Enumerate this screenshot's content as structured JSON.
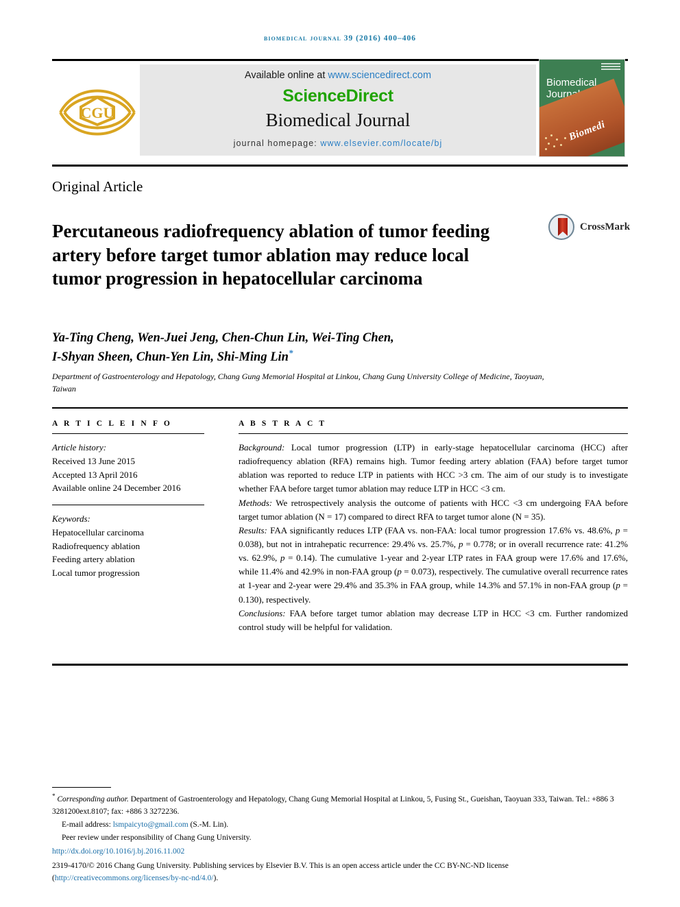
{
  "running_head": "Biomedical Journal 39 (2016) 400–406",
  "masthead": {
    "available_prefix": "Available online at ",
    "available_link": "www.sciencedirect.com",
    "sciencedirect": "ScienceDirect",
    "journal_name": "Biomedical Journal",
    "homepage_prefix": "journal homepage: ",
    "homepage_link": "www.elsevier.com/locate/bj",
    "logo_text": "CGU",
    "cover_title_line1": "Biomedical",
    "cover_title_line2": "Journal",
    "cover_script": "Biomedi"
  },
  "article": {
    "type": "Original Article",
    "title": "Percutaneous radiofrequency ablation of tumor feeding artery before target tumor ablation may reduce local tumor progression in hepatocellular carcinoma",
    "crossmark_label": "CrossMark",
    "authors_line1": "Ya-Ting Cheng, Wen-Juei Jeng, Chen-Chun Lin, Wei-Ting Chen,",
    "authors_line2": "I-Shyan Sheen, Chun-Yen Lin, Shi-Ming Lin",
    "author_star": "*",
    "affiliation": "Department of Gastroenterology and Hepatology, Chang Gung Memorial Hospital at Linkou, Chang Gung University College of Medicine, Taoyuan, Taiwan"
  },
  "article_info": {
    "heading": "A R T I C L E  I N F O",
    "history_label": "Article history:",
    "history": [
      "Received 13 June 2015",
      "Accepted 13 April 2016",
      "Available online 24 December 2016"
    ],
    "keywords_label": "Keywords:",
    "keywords": [
      "Hepatocellular carcinoma",
      "Radiofrequency ablation",
      "Feeding artery ablation",
      "Local tumor progression"
    ]
  },
  "abstract": {
    "heading": "A B S T R A C T",
    "background_label": "Background:",
    "background_text": " Local tumor progression (LTP) in early-stage hepatocellular carcinoma (HCC) after radiofrequency ablation (RFA) remains high. Tumor feeding artery ablation (FAA) before target tumor ablation was reported to reduce LTP in patients with HCC >3 cm. The aim of our study is to investigate whether FAA before target tumor ablation may reduce LTP in HCC <3 cm.",
    "methods_label": "Methods:",
    "methods_text": " We retrospectively analysis the outcome of patients with HCC <3 cm undergoing FAA before target tumor ablation (N = 17) compared to direct RFA to target tumor alone (N = 35).",
    "results_label": "Results:",
    "results_text_1": " FAA significantly reduces LTP (FAA vs. non-FAA: local tumor progression 17.6% vs. 48.6%, ",
    "results_p1": "p",
    "results_text_2": " = 0.038), but not in intrahepatic recurrence: 29.4% vs. 25.7%, ",
    "results_p2": "p",
    "results_text_3": " = 0.778; or in overall recurrence rate: 41.2% vs. 62.9%, ",
    "results_p3": "p",
    "results_text_4": " = 0.14). The cumulative 1-year and 2-year LTP rates in FAA group were 17.6% and 17.6%, while 11.4% and 42.9% in non-FAA group (",
    "results_p4": "p",
    "results_text_5": " = 0.073), respectively. The cumulative overall recurrence rates at 1-year and 2-year were 29.4% and 35.3% in FAA group, while 14.3% and 57.1% in non-FAA group (",
    "results_p5": "p",
    "results_text_6": " = 0.130), respectively.",
    "conclusions_label": "Conclusions:",
    "conclusions_text": " FAA before target tumor ablation may decrease LTP in HCC <3 cm. Further randomized control study will be helpful for validation."
  },
  "footer": {
    "corr_star": "*",
    "corr_label": "Corresponding author.",
    "corr_text": " Department of Gastroenterology and Hepatology, Chang Gung Memorial Hospital at Linkou, 5, Fusing St., Gueishan, Taoyuan 333, Taiwan. Tel.: +886 3 3281200ext.8107; fax: +886 3 3272236.",
    "email_label": "E-mail address: ",
    "email": "lsmpaicyto@gmail.com",
    "email_suffix": " (S.-M. Lin).",
    "peer_review": "Peer review under responsibility of Chang Gung University.",
    "doi": "http://dx.doi.org/10.1016/j.bj.2016.11.002",
    "copyright_pre": "2319-4170/© 2016 Chang Gung University. Publishing services by Elsevier B.V. This is an open access article under the CC BY-NC-ND license (",
    "license_link": "http://creativecommons.org/licenses/by-nc-nd/4.0/",
    "copyright_post": ")."
  },
  "colors": {
    "running_head": "#1a7aa6",
    "sciencedirect_green": "#1fa300",
    "link_blue": "#2b7fc4",
    "cover_green": "#3d7f52",
    "logo_gold": "#d9a521"
  }
}
